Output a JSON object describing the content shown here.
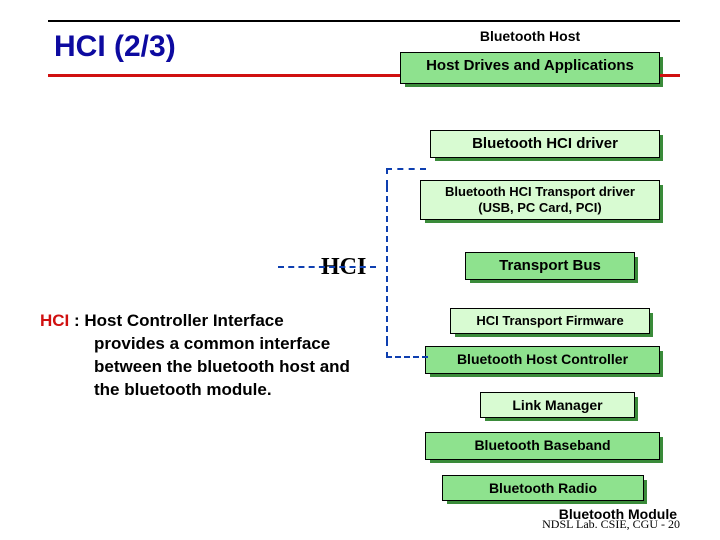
{
  "title": "HCI (2/3)",
  "labels": {
    "bluetooth_host": "Bluetooth Host",
    "bluetooth_module": "Bluetooth Module",
    "hci": "HCI"
  },
  "boxes": {
    "host_drives": "Host Drives and Applications",
    "hci_driver": "Bluetooth HCI driver",
    "transport_driver_l1": "Bluetooth HCI Transport driver",
    "transport_driver_l2": "(USB, PC Card, PCI)",
    "transport_bus": "Transport Bus",
    "transport_firmware": "HCI Transport Firmware",
    "host_controller": "Bluetooth Host Controller",
    "link_manager": "Link Manager",
    "baseband": "Bluetooth Baseband",
    "radio": "Bluetooth Radio"
  },
  "description": {
    "term": "HCI",
    "expansion": " : Host Controller Interface",
    "rest": "provides a common interface between the bluetooth host and the bluetooth module."
  },
  "footer": "NDSL Lab. CSIE, CGU - 20"
}
